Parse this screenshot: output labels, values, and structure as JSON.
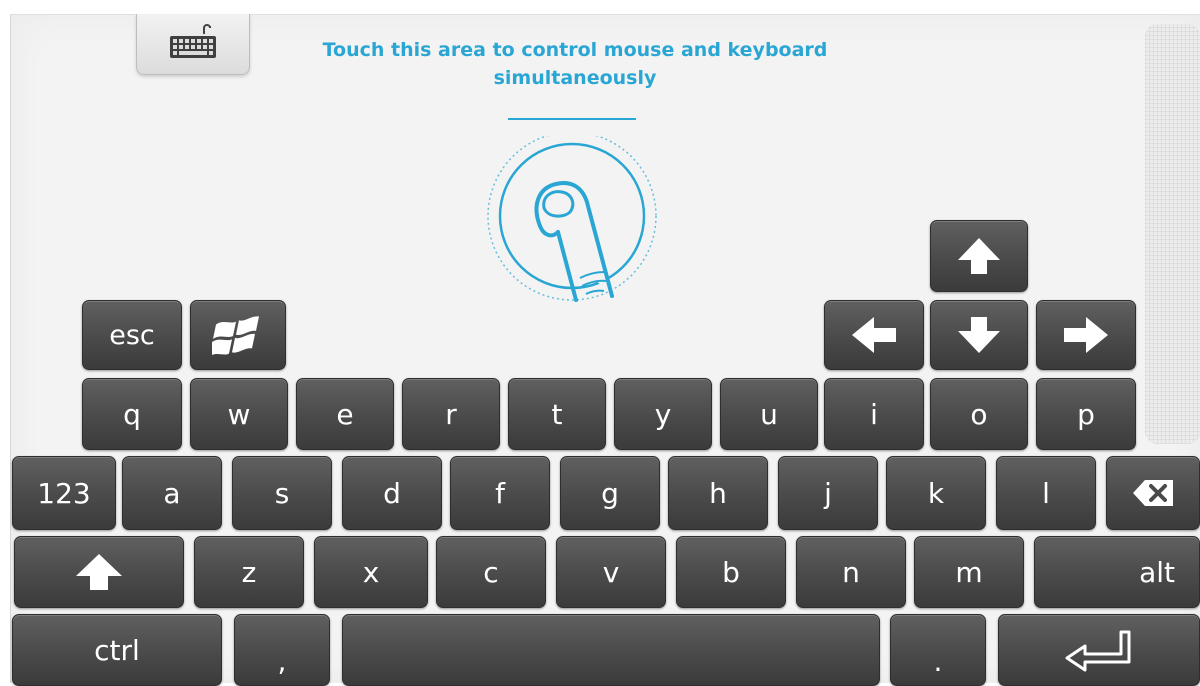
{
  "hint": {
    "line1": "Touch this area to control mouse and keyboard",
    "line2": "simultaneously"
  },
  "icons": {
    "keyboard_toggle": "keyboard-icon",
    "touch": "finger-touch-icon",
    "windows": "windows-logo-icon",
    "arrows": [
      "arrow-up-icon",
      "arrow-left-icon",
      "arrow-down-icon",
      "arrow-right-icon"
    ],
    "shift": "shift-icon",
    "backspace": "backspace-icon",
    "enter": "enter-icon"
  },
  "colors": {
    "accent": "#2aa6d4",
    "key": "#4a4a4a",
    "background": "#f3f3f3"
  },
  "keys": {
    "esc": "esc",
    "row1": [
      "q",
      "w",
      "e",
      "r",
      "t",
      "y",
      "u",
      "i",
      "o",
      "p"
    ],
    "num": "123",
    "row2": [
      "a",
      "s",
      "d",
      "f",
      "g",
      "h",
      "j",
      "k",
      "l"
    ],
    "row3": [
      "z",
      "x",
      "c",
      "v",
      "b",
      "n",
      "m"
    ],
    "alt": "alt",
    "ctrl": "ctrl",
    "comma": ",",
    "period": "."
  }
}
